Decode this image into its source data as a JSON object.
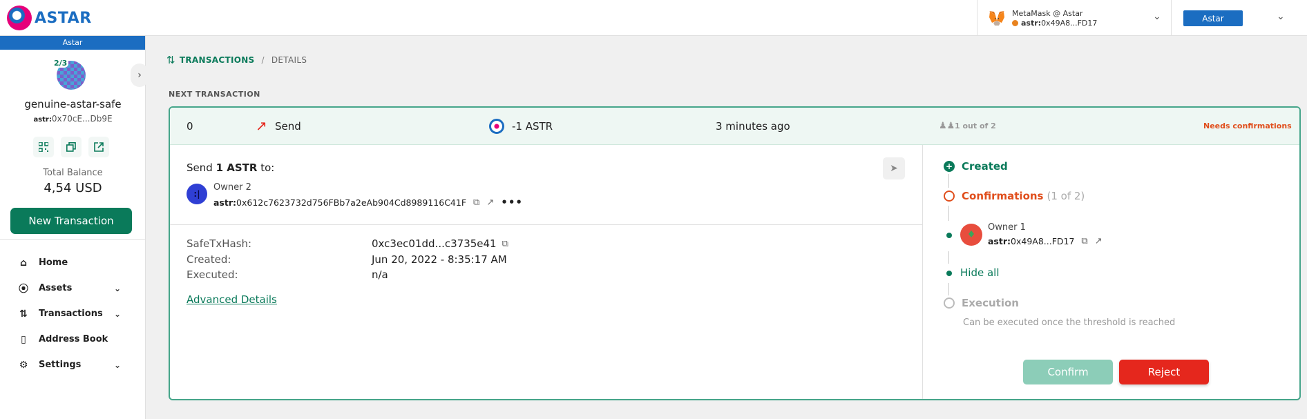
{
  "header": {
    "logo_text": "ASTAR",
    "wallet": {
      "name": "MetaMask @ Astar",
      "addr_prefix": "astr:",
      "addr": "0x49A8...FD17"
    },
    "network": "Astar"
  },
  "sidebar": {
    "network_label": "Astar",
    "threshold": "2/3",
    "safe_name": "genuine-astar-safe",
    "safe_addr_prefix": "astr:",
    "safe_addr": "0x70cE...Db9E",
    "total_label": "Total Balance",
    "total_value": "4,54 USD",
    "new_tx_label": "New Transaction",
    "nav": [
      {
        "label": "Home",
        "icon": "home-icon"
      },
      {
        "label": "Assets",
        "icon": "assets-icon"
      },
      {
        "label": "Transactions",
        "icon": "transactions-icon"
      },
      {
        "label": "Address Book",
        "icon": "address-book-icon"
      },
      {
        "label": "Settings",
        "icon": "settings-icon"
      }
    ]
  },
  "breadcrumb": {
    "transactions": "TRANSACTIONS",
    "separator": "/",
    "details": "DETAILS"
  },
  "section_label": "NEXT TRANSACTION",
  "tx": {
    "nonce": "0",
    "type": "Send",
    "amount": "-1 ASTR",
    "time": "3 minutes ago",
    "owners": "1 out of 2",
    "status": "Needs confirmations",
    "send_prefix": "Send",
    "send_amount": "1 ASTR",
    "send_suffix": "to:",
    "recipient_name": "Owner 2",
    "recipient_prefix": "astr:",
    "recipient_addr": "0x612c7623732d756FBb7a2eAb904Cd8989116C41F",
    "details": {
      "hash_label": "SafeTxHash:",
      "hash_value": "0xc3ec01dd...c3735e41",
      "created_label": "Created:",
      "created_value": "Jun 20, 2022 - 8:35:17 AM",
      "executed_label": "Executed:",
      "executed_value": "n/a"
    },
    "advanced": "Advanced Details"
  },
  "timeline": {
    "created": "Created",
    "confirmations": "Confirmations",
    "confirmations_count": "(1 of 2)",
    "owner_name": "Owner 1",
    "owner_prefix": "astr:",
    "owner_addr": "0x49A8...FD17",
    "hide_all": "Hide all",
    "execution": "Execution",
    "execution_note": "Can be executed once the threshold is reached",
    "confirm_label": "Confirm",
    "reject_label": "Reject"
  },
  "colors": {
    "primary": "#0a7a5a",
    "brand": "#1b6dc1",
    "reject": "#e5271d",
    "warning": "#e04e1c"
  }
}
